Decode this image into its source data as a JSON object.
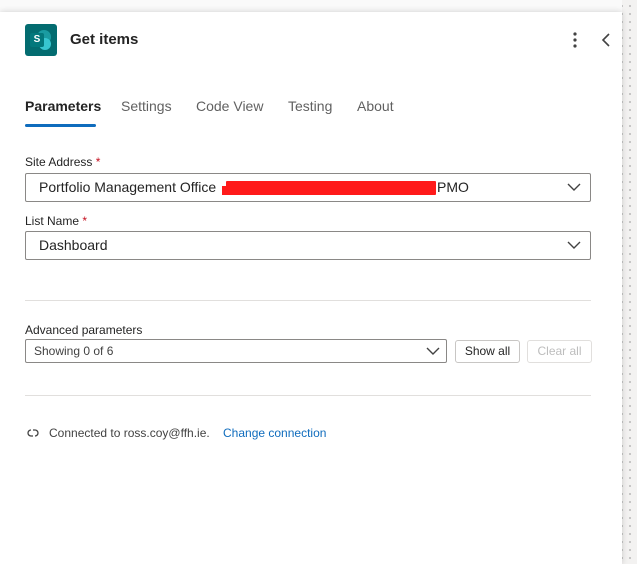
{
  "header": {
    "title": "Get items",
    "app_icon_letter": "S",
    "icons": {
      "app": "sharepoint-icon",
      "more": "more-vertical-icon",
      "collapse": "chevron-left-icon"
    }
  },
  "tabs": [
    {
      "label": "Parameters",
      "active": true
    },
    {
      "label": "Settings",
      "active": false
    },
    {
      "label": "Code View",
      "active": false
    },
    {
      "label": "Testing",
      "active": false
    },
    {
      "label": "About",
      "active": false
    }
  ],
  "fields": {
    "site_address": {
      "label": "Site Address",
      "required_mark": "*",
      "value_prefix": "Portfolio Management Office",
      "value_suffix": "PMO"
    },
    "list_name": {
      "label": "List Name",
      "required_mark": "*",
      "value": "Dashboard"
    }
  },
  "advanced": {
    "label": "Advanced parameters",
    "value": "Showing 0 of 6",
    "show_all_label": "Show all",
    "clear_all_label": "Clear all"
  },
  "connection": {
    "text": "Connected to ross.coy@ffh.ie.",
    "link_label": "Change connection"
  },
  "colors": {
    "accent": "#0f6cbd",
    "required": "#c50f1f",
    "sharepoint": "#036c70",
    "redaction": "#ff1a1a"
  }
}
